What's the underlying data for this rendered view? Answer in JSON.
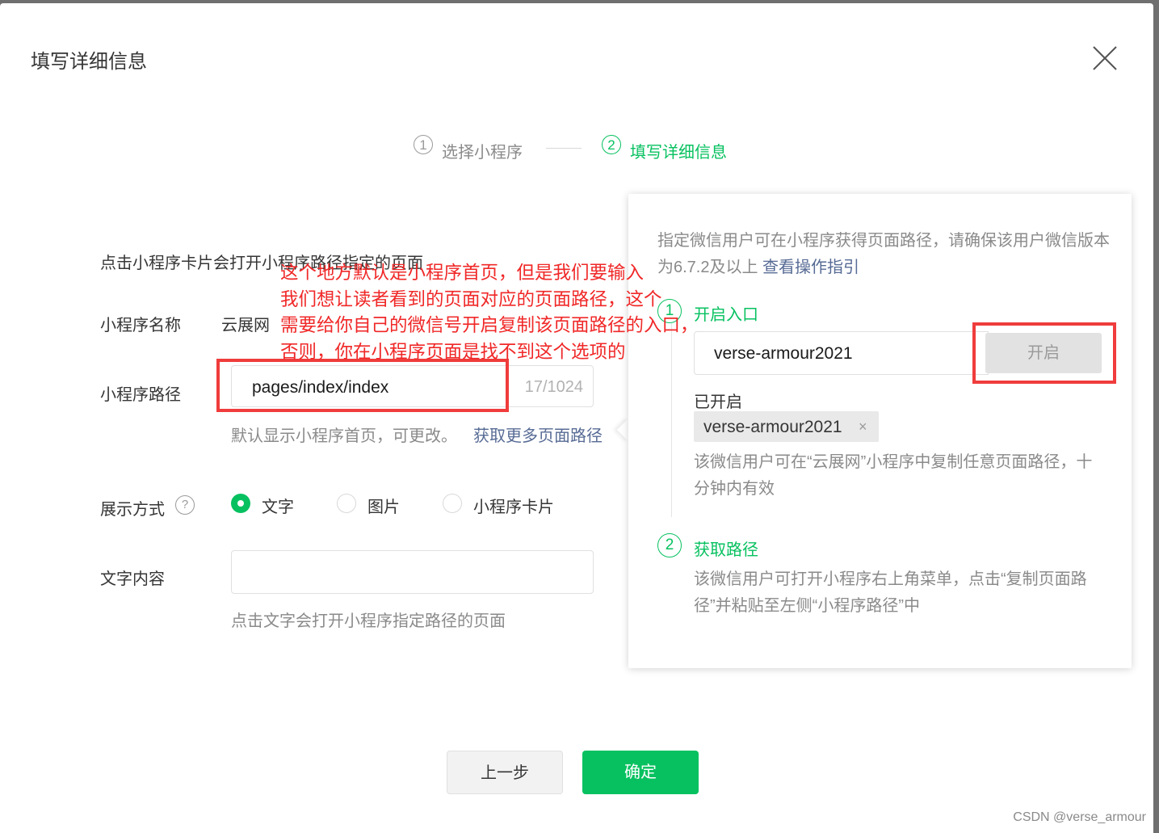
{
  "dialog": {
    "title": "填写详细信息"
  },
  "steps": [
    {
      "num": "1",
      "label": "选择小程序",
      "state": "done"
    },
    {
      "num": "2",
      "label": "填写详细信息",
      "state": "active"
    }
  ],
  "form": {
    "description": "点击小程序卡片会打开小程序路径指定的页面",
    "name_label": "小程序名称",
    "name_value": "云展网",
    "path_label": "小程序路径",
    "path_value": "pages/index/index",
    "path_count": "17/1024",
    "path_hint": "默认显示小程序首页，可更改。",
    "path_link": "获取更多页面路径",
    "display_label": "展示方式",
    "help_icon": "?",
    "display_options": [
      {
        "label": "文字",
        "selected": true
      },
      {
        "label": "图片",
        "selected": false
      },
      {
        "label": "小程序卡片",
        "selected": false
      }
    ],
    "text_label": "文字内容",
    "text_value": "",
    "text_hint": "点击文字会打开小程序指定路径的页面"
  },
  "popover": {
    "desc": "指定微信用户可在小程序获得页面路径，请确保该用户微信版本为6.7.2及以上",
    "desc_link": "查看操作指引",
    "step1_num": "1",
    "step1_title": "开启入口",
    "wechat_id_value": "verse-armour2021",
    "open_button": "开启",
    "opened_label": "已开启",
    "opened_tag": "verse-armour2021",
    "tag_close": "×",
    "step1_note": "该微信用户可在“云展网”小程序中复制任意页面路径，十分钟内有效",
    "step2_num": "2",
    "step2_title": "获取路径",
    "step2_note": "该微信用户可打开小程序右上角菜单，点击“复制页面路径”并粘贴至左侧“小程序路径”中"
  },
  "annotation": {
    "lines": [
      "这个地方默认是小程序首页，但是我们要输入",
      "我们想让读者看到的页面对应的页面路径，这个",
      "需要给你自己的微信号开启复制该页面路径的入口，",
      "否则，你在小程序页面是找不到这个选项的"
    ],
    "color": "#f03c3c"
  },
  "footer": {
    "prev_button": "上一步",
    "confirm_button": "确定"
  },
  "watermark": "CSDN @verse_armour",
  "colors": {
    "accent": "#07c160",
    "link": "#576b95",
    "annotation": "#f03c3c"
  }
}
